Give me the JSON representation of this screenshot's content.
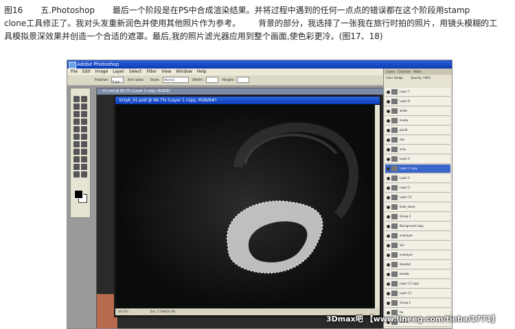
{
  "article": {
    "line1_fig": "图16",
    "line1_heading": "五.Photoshop",
    "line1_text": "最后一个阶段是在PS中合成渲染结果。并将过程中遇到的任何一点点的错误都在这个阶段用stamp",
    "line2_text": "clone工具修正了。我对头发重新润色并使用其他照片作为参考。",
    "line2_text_b": "背景的部分，我选择了一张我在旅行时拍的照片，用镜头模糊的工",
    "line3_text": "具模拟景深效果并创造一个合适的遮罩。最后,我的照片滤光器应用到整个画面,使色彩更冷。(图17、18)"
  },
  "photoshop": {
    "title": "Adobe Photoshop",
    "menu": [
      "File",
      "Edit",
      "Image",
      "Layer",
      "Select",
      "Filter",
      "View",
      "Window",
      "Help"
    ],
    "options": {
      "feather_label": "Feather:",
      "feather_value": "0 px",
      "antialias_label": "Anti-alias",
      "style_label": "Style:",
      "style_value": "Normal",
      "width_label": "Width:",
      "height_label": "Height:"
    },
    "back_document_title": "...01.psd @ 66.7% (Layer 1 copy, RGB/8)",
    "document_title": "krzyk_01.psd @ 66.7% (Layer 1 copy, RGB/8#)",
    "status_zoom": "66.67%",
    "status_doc": "Doc: 3.79M/34.4M",
    "panel_tabs": [
      "Layers",
      "Channels",
      "Paths"
    ],
    "blend_mode": "Color Dodge",
    "opacity_label": "Opacity:",
    "opacity_value": "100%",
    "layers": [
      "Layer 7",
      "Layer 8",
      "white",
      "linedu",
      "parzd",
      "oko",
      "oczy",
      "Layer 4",
      "Layer 1 copy",
      "Layer 1",
      "Layer 2",
      "Layer 12",
      "kolor_skora",
      "Group 2",
      "Background copy",
      "overlayre",
      "lips",
      "overlayre",
      "brwidy2",
      "brwidy",
      "Layer 11 copy",
      "Layer 11",
      "Group 1",
      "tlo",
      "warne"
    ],
    "active_layer_index": 8
  },
  "watermark": "3Dmax吧 【www.lineeg.com/tieba/1771】",
  "colors": {
    "titlebar": "#0b3bb4",
    "canvas": "#0a0c0b",
    "active_layer": "#3a66c9"
  }
}
